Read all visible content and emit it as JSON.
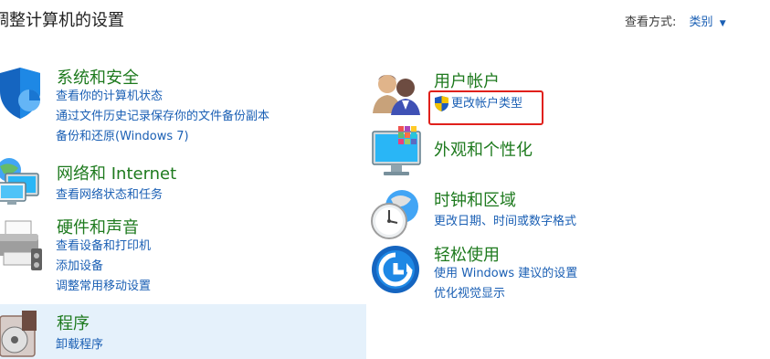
{
  "header": {
    "title": "调整计算机的设置",
    "view_by_label": "查看方式:",
    "view_by_value": "类别"
  },
  "categories": [
    {
      "title": "系统和安全",
      "icon": "shield-icon",
      "links": [
        "查看你的计算机状态",
        "通过文件历史记录保存你的文件备份副本",
        "备份和还原(Windows 7)"
      ]
    },
    {
      "title": "网络和 Internet",
      "icon": "network-icon",
      "links": [
        "查看网络状态和任务"
      ]
    },
    {
      "title": "硬件和声音",
      "icon": "printer-icon",
      "links": [
        "查看设备和打印机",
        "添加设备",
        "调整常用移动设置"
      ]
    },
    {
      "title": "程序",
      "icon": "programs-icon",
      "links": [
        "卸载程序"
      ]
    },
    {
      "title": "用户帐户",
      "icon": "users-icon",
      "links": [
        "更改帐户类型"
      ]
    },
    {
      "title": "外观和个性化",
      "icon": "monitor-icon",
      "links": []
    },
    {
      "title": "时钟和区域",
      "icon": "clock-globe-icon",
      "links": [
        "更改日期、时间或数字格式"
      ]
    },
    {
      "title": "轻松使用",
      "icon": "ease-of-access-icon",
      "links": [
        "使用 Windows 建议的设置",
        "优化视觉显示"
      ]
    }
  ],
  "colors": {
    "category_title": "#1e7a1e",
    "link": "#1a5fb4",
    "highlight_bg": "#e5f1fb",
    "annotation_box": "#e0201b"
  }
}
